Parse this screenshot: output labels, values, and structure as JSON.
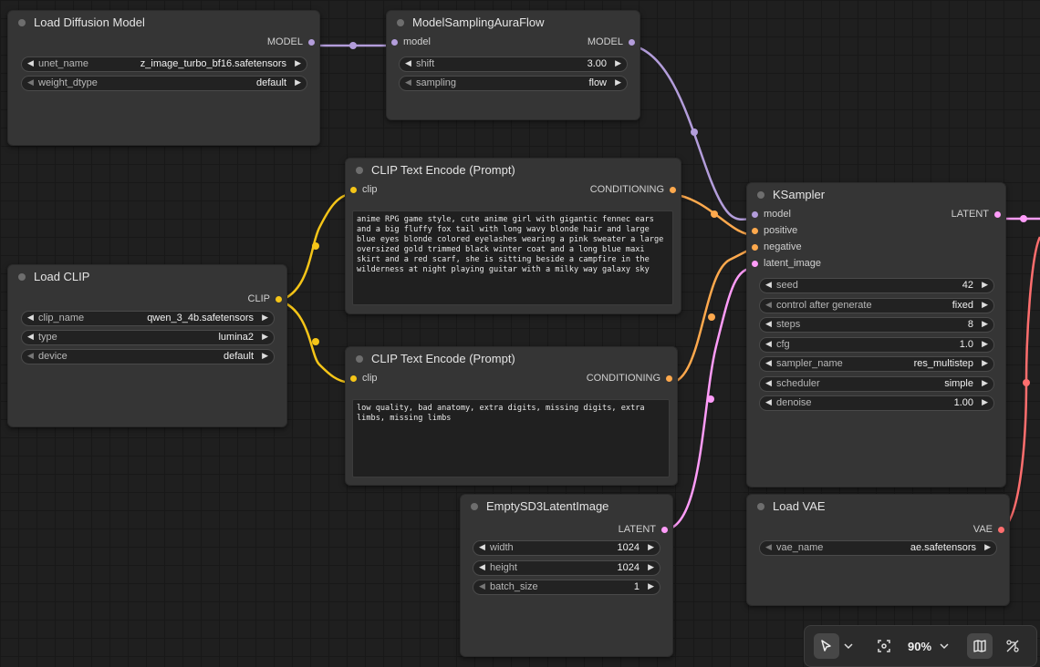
{
  "colors": {
    "model": "#b39ddb",
    "clip": "#f5c518",
    "conditioning": "#ffa94d",
    "latent": "#ff9cf9",
    "vae": "#ff6e6e"
  },
  "nodes": {
    "load_diffusion": {
      "title": "Load Diffusion Model",
      "output": "MODEL",
      "widgets": [
        {
          "label": "unet_name",
          "value": "z_image_turbo_bf16.safetensors"
        },
        {
          "label": "weight_dtype",
          "value": "default"
        }
      ]
    },
    "model_sampling": {
      "title": "ModelSamplingAuraFlow",
      "input": "model",
      "output": "MODEL",
      "widgets": [
        {
          "label": "shift",
          "value": "3.00"
        },
        {
          "label": "sampling",
          "value": "flow"
        }
      ]
    },
    "clip_pos": {
      "title": "CLIP Text Encode (Prompt)",
      "input": "clip",
      "output": "CONDITIONING",
      "text": "anime RPG game style, cute anime girl with gigantic fennec ears and a big fluffy fox tail with long wavy blonde hair and large blue eyes blonde colored eyelashes wearing a pink sweater a large oversized gold trimmed black winter coat and a long blue maxi skirt and a red scarf, she is sitting beside a campfire in the wilderness at night playing guitar with a milky way galaxy sky"
    },
    "clip_neg": {
      "title": "CLIP Text Encode (Prompt)",
      "input": "clip",
      "output": "CONDITIONING",
      "text": "low quality, bad anatomy, extra digits, missing digits, extra limbs, missing limbs"
    },
    "load_clip": {
      "title": "Load CLIP",
      "output": "CLIP",
      "widgets": [
        {
          "label": "clip_name",
          "value": "qwen_3_4b.safetensors"
        },
        {
          "label": "type",
          "value": "lumina2"
        },
        {
          "label": "device",
          "value": "default"
        }
      ]
    },
    "ksampler": {
      "title": "KSampler",
      "inputs": [
        "model",
        "positive",
        "negative",
        "latent_image"
      ],
      "output": "LATENT",
      "widgets": [
        {
          "label": "seed",
          "value": "42"
        },
        {
          "label": "control after generate",
          "value": "fixed"
        },
        {
          "label": "steps",
          "value": "8"
        },
        {
          "label": "cfg",
          "value": "1.0"
        },
        {
          "label": "sampler_name",
          "value": "res_multistep"
        },
        {
          "label": "scheduler",
          "value": "simple"
        },
        {
          "label": "denoise",
          "value": "1.00"
        }
      ]
    },
    "empty_latent": {
      "title": "EmptySD3LatentImage",
      "output": "LATENT",
      "widgets": [
        {
          "label": "width",
          "value": "1024"
        },
        {
          "label": "height",
          "value": "1024"
        },
        {
          "label": "batch_size",
          "value": "1"
        }
      ]
    },
    "load_vae": {
      "title": "Load VAE",
      "output": "VAE",
      "widgets": [
        {
          "label": "vae_name",
          "value": "ae.safetensors"
        }
      ]
    }
  },
  "toolbar": {
    "zoom": "90%",
    "icons": [
      "select-pointer-icon",
      "chevron-down-icon",
      "fit-view-icon",
      "chevron-down-icon",
      "minimap-icon",
      "toggle-links-icon"
    ]
  }
}
